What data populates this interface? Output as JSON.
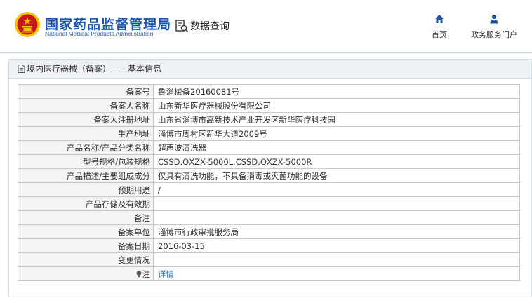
{
  "header": {
    "logo_cn": "国家药品监督管理局",
    "logo_en": "National Medical Products Administration",
    "data_query": "数据查询",
    "nav": {
      "home": "首页",
      "portal": "政务服务门户"
    }
  },
  "panel": {
    "breadcrumb": "境内医疗器械（备案）——基本信息"
  },
  "rows": [
    {
      "label": "备案号",
      "value": "鲁淄械备20160081号"
    },
    {
      "label": "备案人名称",
      "value": "山东新华医疗器械股份有限公司"
    },
    {
      "label": "备案人注册地址",
      "value": "山东省淄博市高新技术产业开发区新华医疗科技园"
    },
    {
      "label": "生产地址",
      "value": "淄博市周村区新华大道2009号"
    },
    {
      "label": "产品名称/产品分类名称",
      "value": "超声波清洗器"
    },
    {
      "label": "型号规格/包装规格",
      "value": "CSSD.QXZX-5000L,CSSD.QXZX-5000R"
    },
    {
      "label": "产品描述/主要组成成分",
      "value": "仅具有清洗功能，不具备消毒或灭菌功能的设备"
    },
    {
      "label": "预期用途",
      "value": "/"
    },
    {
      "label": "产品存储及有效期",
      "value": ""
    },
    {
      "label": "备注",
      "value": ""
    },
    {
      "label": "备案单位",
      "value": "淄博市行政审批服务局"
    },
    {
      "label": "备案日期",
      "value": "2016-03-15"
    },
    {
      "label": "变更情况",
      "value": ""
    }
  ],
  "note": {
    "label": "注",
    "link": "详情"
  },
  "colors": {
    "brand": "#1a56a8",
    "emblem_red": "#c8161d",
    "emblem_gold": "#f5c400",
    "link": "#2f6fbf"
  },
  "icons": {
    "emblem": "national-emblem-icon",
    "search": "document-search-icon",
    "home": "home-icon",
    "portal": "user-icon",
    "doc": "document-icon",
    "bulb": "lightbulb-icon"
  }
}
